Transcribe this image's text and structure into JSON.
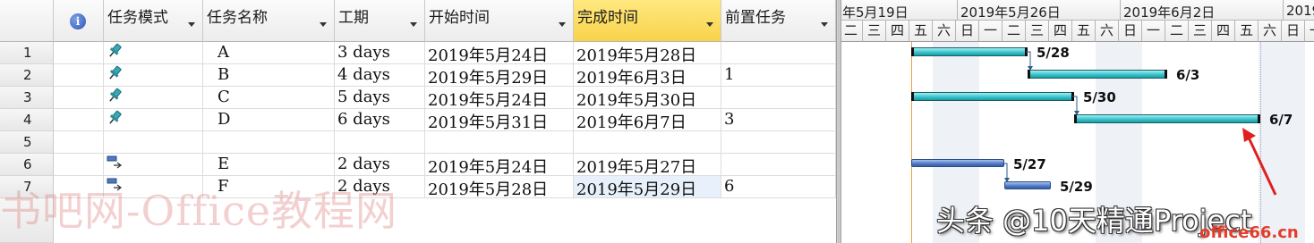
{
  "table": {
    "columns": [
      {
        "label": ""
      },
      {
        "label": "i"
      },
      {
        "label": "任务模式"
      },
      {
        "label": "任务名称"
      },
      {
        "label": "工期"
      },
      {
        "label": "开始时间"
      },
      {
        "label": "完成时间"
      },
      {
        "label": "前置任务"
      }
    ],
    "rows": [
      {
        "id": "1",
        "mode": "manual",
        "name": "A",
        "duration": "3 days",
        "start": "2019年5月24日",
        "finish": "2019年5月28日",
        "pred": ""
      },
      {
        "id": "2",
        "mode": "manual",
        "name": "B",
        "duration": "4 days",
        "start": "2019年5月29日",
        "finish": "2019年6月3日",
        "pred": "1"
      },
      {
        "id": "3",
        "mode": "manual",
        "name": "C",
        "duration": "5 days",
        "start": "2019年5月24日",
        "finish": "2019年5月30日",
        "pred": ""
      },
      {
        "id": "4",
        "mode": "manual",
        "name": "D",
        "duration": "6 days",
        "start": "2019年5月31日",
        "finish": "2019年6月7日",
        "pred": "3"
      },
      {
        "id": "5",
        "mode": "",
        "name": "",
        "duration": "",
        "start": "",
        "finish": "",
        "pred": ""
      },
      {
        "id": "6",
        "mode": "auto",
        "name": "E",
        "duration": "2 days",
        "start": "2019年5月24日",
        "finish": "2019年5月27日",
        "pred": ""
      },
      {
        "id": "7",
        "mode": "auto",
        "name": "F",
        "duration": "2 days",
        "start": "2019年5月28日",
        "finish": "2019年5月29日",
        "pred": "6"
      }
    ]
  },
  "gantt": {
    "weeks": [
      "年5月19日",
      "2019年5月26日",
      "2019年6月2日",
      "2019"
    ],
    "days": [
      "二",
      "三",
      "四",
      "五",
      "六",
      "日",
      "一",
      "二",
      "三",
      "四",
      "五",
      "六",
      "日",
      "一",
      "二",
      "三",
      "四",
      "五",
      "六",
      "日",
      "一"
    ],
    "bar_labels": [
      "5/28",
      "6/3",
      "5/30",
      "6/7",
      "5/27",
      "5/29"
    ]
  },
  "watermark": "书吧网-Office教程网",
  "credit": "头条 @10天精通Project",
  "site": "office66.cn",
  "colors": {
    "manual_bar": "#3cc4cb",
    "auto_bar": "#4f78c5",
    "selected_header": "#f8d24a",
    "today_line": "#f0a040",
    "arrow": "#e02020"
  }
}
